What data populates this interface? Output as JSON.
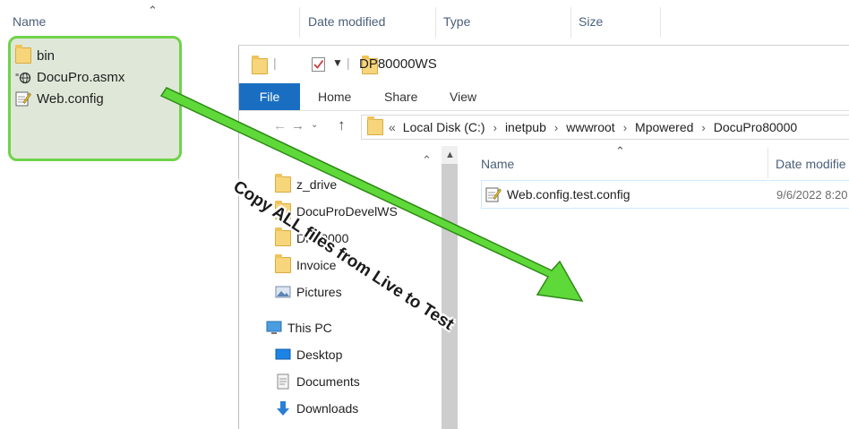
{
  "background_list": {
    "columns": {
      "name": "Name",
      "date_modified": "Date modified",
      "type": "Type",
      "size": "Size"
    },
    "files": [
      {
        "label": "bin",
        "icon": "folder-icon"
      },
      {
        "label": "DocuPro.asmx",
        "icon": "web-service-file-icon"
      },
      {
        "label": "Web.config",
        "icon": "config-file-icon"
      }
    ]
  },
  "window": {
    "title": "DP80000WS",
    "ribbon_tabs": [
      "File",
      "Home",
      "Share",
      "View"
    ],
    "address": {
      "prefix": "«",
      "crumbs": [
        "Local Disk (C:)",
        "inetpub",
        "wwwroot",
        "Mpowered",
        "DocuPro80000"
      ]
    },
    "nav_items": [
      "z_drive",
      "DocuProDevelWS",
      "DP80000",
      "Invoice",
      "Pictures",
      "This PC",
      "Desktop",
      "Documents",
      "Downloads"
    ],
    "content_columns": {
      "name": "Name",
      "date_modified": "Date modifie"
    },
    "content_rows": [
      {
        "name": "Web.config.test.config",
        "date": "9/6/2022 8:20"
      }
    ]
  },
  "annotation": {
    "text": "Copy ALL files from Live to Test",
    "color": "#5fd93a"
  }
}
